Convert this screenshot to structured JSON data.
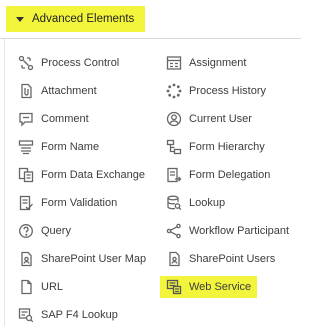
{
  "section": {
    "title": "Advanced Elements"
  },
  "left_items": [
    {
      "label": "Process Control",
      "icon": "process-control-icon"
    },
    {
      "label": "Attachment",
      "icon": "attachment-icon"
    },
    {
      "label": "Comment",
      "icon": "comment-icon"
    },
    {
      "label": "Form Name",
      "icon": "form-name-icon"
    },
    {
      "label": "Form Data Exchange",
      "icon": "form-data-exchange-icon"
    },
    {
      "label": "Form Validation",
      "icon": "form-validation-icon"
    },
    {
      "label": "Query",
      "icon": "query-icon"
    },
    {
      "label": "SharePoint User Map",
      "icon": "sharepoint-user-map-icon"
    },
    {
      "label": "URL",
      "icon": "url-icon"
    },
    {
      "label": "SAP F4 Lookup",
      "icon": "sap-f4-lookup-icon"
    }
  ],
  "right_items": [
    {
      "label": "Assignment",
      "icon": "assignment-icon"
    },
    {
      "label": "Process History",
      "icon": "process-history-icon"
    },
    {
      "label": "Current User",
      "icon": "current-user-icon"
    },
    {
      "label": "Form Hierarchy",
      "icon": "form-hierarchy-icon"
    },
    {
      "label": "Form Delegation",
      "icon": "form-delegation-icon"
    },
    {
      "label": "Lookup",
      "icon": "lookup-icon"
    },
    {
      "label": "Workflow Participant",
      "icon": "workflow-participant-icon"
    },
    {
      "label": "SharePoint Users",
      "icon": "sharepoint-users-icon"
    },
    {
      "label": "Web Service",
      "icon": "web-service-icon",
      "highlighted": true
    }
  ],
  "colors": {
    "highlight": "#f2f53c",
    "icon": "#6b6b6b",
    "text": "#3c3c3c"
  }
}
